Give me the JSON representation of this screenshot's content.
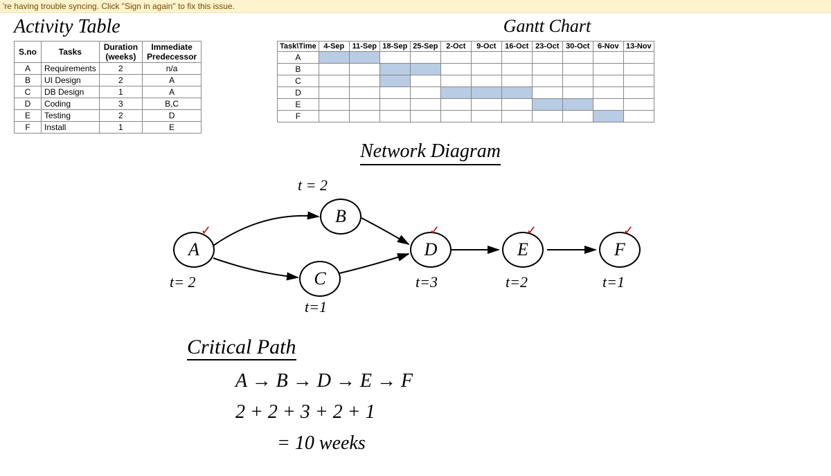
{
  "warning": "'re having trouble syncing. Click \"Sign in again\" to fix this issue.",
  "titles": {
    "activity": "Activity Table",
    "gantt": "Gantt Chart",
    "network": "Network Diagram",
    "critical": "Critical Path"
  },
  "activity_table": {
    "headers": [
      "S.no",
      "Tasks",
      "Duration (weeks)",
      "Immediate Predecessor"
    ],
    "rows": [
      {
        "sno": "A",
        "task": "Requirements",
        "dur": "2",
        "pred": "n/a"
      },
      {
        "sno": "B",
        "task": "UI Design",
        "dur": "2",
        "pred": "A"
      },
      {
        "sno": "C",
        "task": "DB Design",
        "dur": "1",
        "pred": "A"
      },
      {
        "sno": "D",
        "task": "Coding",
        "dur": "3",
        "pred": "B,C"
      },
      {
        "sno": "E",
        "task": "Testing",
        "dur": "2",
        "pred": "D"
      },
      {
        "sno": "F",
        "task": "Install",
        "dur": "1",
        "pred": "E"
      }
    ]
  },
  "gantt": {
    "time_header": "Task\\Time",
    "weeks": [
      "4-Sep",
      "11-Sep",
      "18-Sep",
      "25-Sep",
      "2-Oct",
      "9-Oct",
      "16-Oct",
      "23-Oct",
      "30-Oct",
      "6-Nov",
      "13-Nov"
    ],
    "tasks": [
      "A",
      "B",
      "C",
      "D",
      "E",
      "F"
    ],
    "bars": {
      "A": [
        1,
        2
      ],
      "B": [
        3,
        4
      ],
      "C": [
        3
      ],
      "D": [
        5,
        6,
        7
      ],
      "E": [
        8,
        9
      ],
      "F": [
        10
      ]
    }
  },
  "nodes": {
    "A": {
      "label": "A",
      "t": "t= 2"
    },
    "B": {
      "label": "B",
      "t": "t = 2"
    },
    "C": {
      "label": "C",
      "t": "t=1"
    },
    "D": {
      "label": "D",
      "t": "t=3"
    },
    "E": {
      "label": "E",
      "t": "t=2"
    },
    "F": {
      "label": "F",
      "t": "t=1"
    }
  },
  "critical_path": {
    "seq": "A → B → D → E → F",
    "sum": "2 + 2 + 3 + 2 + 1",
    "result": "= 10 weeks"
  }
}
